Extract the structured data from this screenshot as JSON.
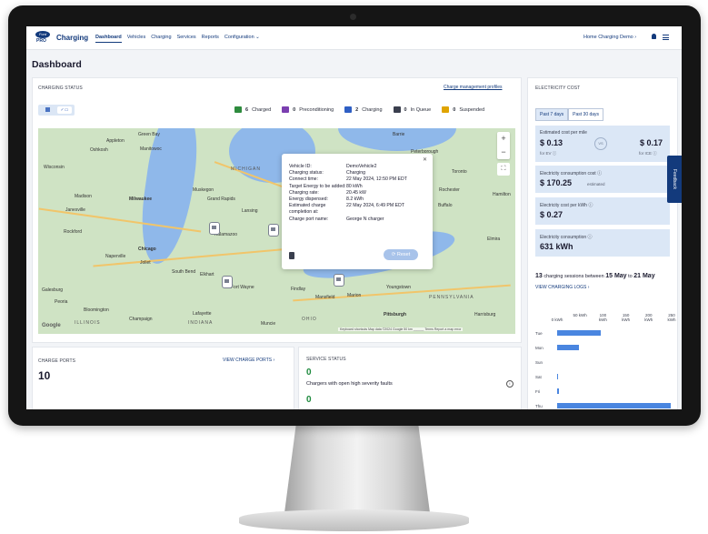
{
  "app": {
    "logo_text": "Ford",
    "logo_sub": "PRO",
    "brand": "Charging",
    "nav": [
      "Dashboard",
      "Vehicles",
      "Charging",
      "Services",
      "Reports",
      "Configuration ⌄"
    ],
    "tenant": "Home Charging Demo ›",
    "feedback": "Feedback"
  },
  "page": {
    "title": "Dashboard"
  },
  "charging_status": {
    "title": "CHARGING STATUS",
    "link": "Charge management profiles",
    "legend": [
      {
        "count": "6",
        "label": "Charged",
        "color": "#2e8b3e"
      },
      {
        "count": "0",
        "label": "Preconditioning",
        "color": "#7b3fb0"
      },
      {
        "count": "2",
        "label": "Charging",
        "color": "#2f5fc4"
      },
      {
        "count": "0",
        "label": "In Queue",
        "color": "#3a3f4e"
      },
      {
        "count": "0",
        "label": "Suspended",
        "color": "#e0a400"
      }
    ],
    "map": {
      "google": "Google",
      "attribution": "Keyboard shortcuts   Map data ©2024 Google   50 km ______   Terms   Report a map error",
      "cities": [
        "Green Bay",
        "Appleton",
        "Oshkosh",
        "Manitowoc",
        "Wisconsin",
        "Madison",
        "Milwaukee",
        "Janesville",
        "Rockford",
        "Chicago",
        "Naperville",
        "Joliet",
        "Galesburg",
        "Peoria",
        "Bloomington",
        "Champaign",
        "Lafayette",
        "Muncie",
        "South Bend",
        "Elkhart",
        "Fort Wayne",
        "Grand Rapids",
        "Lansing",
        "Muskegon",
        "Kalamazoo",
        "Findlay",
        "Mansfield",
        "Marion",
        "Youngstown",
        "Pittsburgh",
        "Harrisburg",
        "Buffalo",
        "Rochester",
        "Peterborough",
        "Barrie",
        "Toronto",
        "Elmira",
        "Hamilton"
      ],
      "regions": [
        "MICHIGAN",
        "ILLINOIS",
        "INDIANA",
        "OHIO",
        "PENNSYLVANIA"
      ],
      "popup": {
        "rows": [
          {
            "k": "Vehicle ID:",
            "v": "DemoVehicle2"
          },
          {
            "k": "Charging status:",
            "v": "Charging"
          },
          {
            "k": "Connect time:",
            "v": "22 May 2024, 12:50 PM EDT"
          },
          {
            "k": "Target Energy to be added:",
            "v": "80 kWh"
          },
          {
            "k": "Charging rate:",
            "v": "20.45 kW"
          },
          {
            "k": "Energy dispensed:",
            "v": "8.2 kWh"
          },
          {
            "k": "Estimated charge completion at:",
            "v": "22 May 2024, 6:49 PM EDT"
          },
          {
            "k": "Charge port name:",
            "v": "George N charger"
          }
        ],
        "reset": "⟳ Reset"
      }
    }
  },
  "electricity_cost": {
    "title": "ELECTRICITY COST",
    "tabs": [
      "Past 7 days",
      "Past 30 days"
    ],
    "per_mile": {
      "label": "Estimated cost per mile",
      "ev": "$ 0.13",
      "ev_sub": "for EV ⓘ",
      "vs": "VS",
      "ice": "$ 0.17",
      "ice_sub": "for ICE ⓘ"
    },
    "consumption_cost": {
      "label": "Electricity consumption cost ⓘ",
      "value": "$ 170.25",
      "sub": "estimated"
    },
    "per_kwh": {
      "label": "Electricity cost per kWh ⓘ",
      "value": "$ 0.27"
    },
    "consumption": {
      "label": "Electricity consumption ⓘ",
      "value": "631 kWh"
    },
    "sessions": {
      "count": "13",
      "text": "charging sessions between",
      "from": "15 May",
      "to_word": "to",
      "to": "21 May"
    },
    "view_logs": "VIEW CHARGING LOGS ›"
  },
  "chart_data": {
    "type": "bar",
    "orientation": "horizontal",
    "x_ticks": [
      "0 kWh",
      "50 kWh",
      "100 kWh",
      "150 kWh",
      "200 kWh",
      "250 kWh"
    ],
    "xlim": [
      0,
      250
    ],
    "categories": [
      "Tue",
      "Mon",
      "Sun",
      "Sat",
      "Fri",
      "Thu"
    ],
    "values": [
      95,
      48,
      0,
      1,
      4,
      248
    ]
  },
  "charge_ports": {
    "title": "CHARGE PORTS",
    "link": "VIEW CHARGE PORTS ›",
    "count": "10"
  },
  "service_status": {
    "title": "SERVICE STATUS",
    "count": "0",
    "desc": "Chargers with open high severity faults",
    "count2": "0"
  }
}
